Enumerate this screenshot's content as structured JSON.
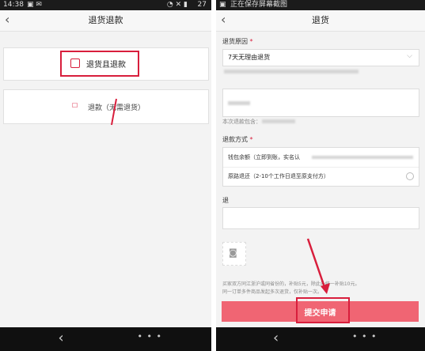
{
  "left": {
    "status": {
      "time": "14:38",
      "battery": "27"
    },
    "nav": {
      "title": "退货退款"
    },
    "option1": {
      "label": "退货且退款"
    },
    "option2": {
      "label": "退款（无需退货）"
    }
  },
  "right": {
    "status": {
      "text": "正在保存屏幕截图"
    },
    "nav": {
      "title": "退货"
    },
    "reason": {
      "label": "退货原因",
      "required": "*",
      "value": "7天无理由退货"
    },
    "amount": {
      "note_prefix": "本次退款包含："
    },
    "method": {
      "label": "退款方式",
      "required": "*",
      "options": [
        "钱包余额（立即到账，实名认",
        "原路退还（2-10个工作日退至原支付方）"
      ]
    },
    "desc": {
      "label": "退"
    },
    "notice": {
      "line1": "买家双方同江浙沪或同省份的，补贴5元，除此外统一补贴10元。",
      "line2": "同一订单多件商品发起多次退货，仅补贴一次。"
    },
    "submit": {
      "label": "提交申请"
    }
  },
  "colors": {
    "accent": "#d81e3c",
    "submit_bg": "#f06573"
  }
}
